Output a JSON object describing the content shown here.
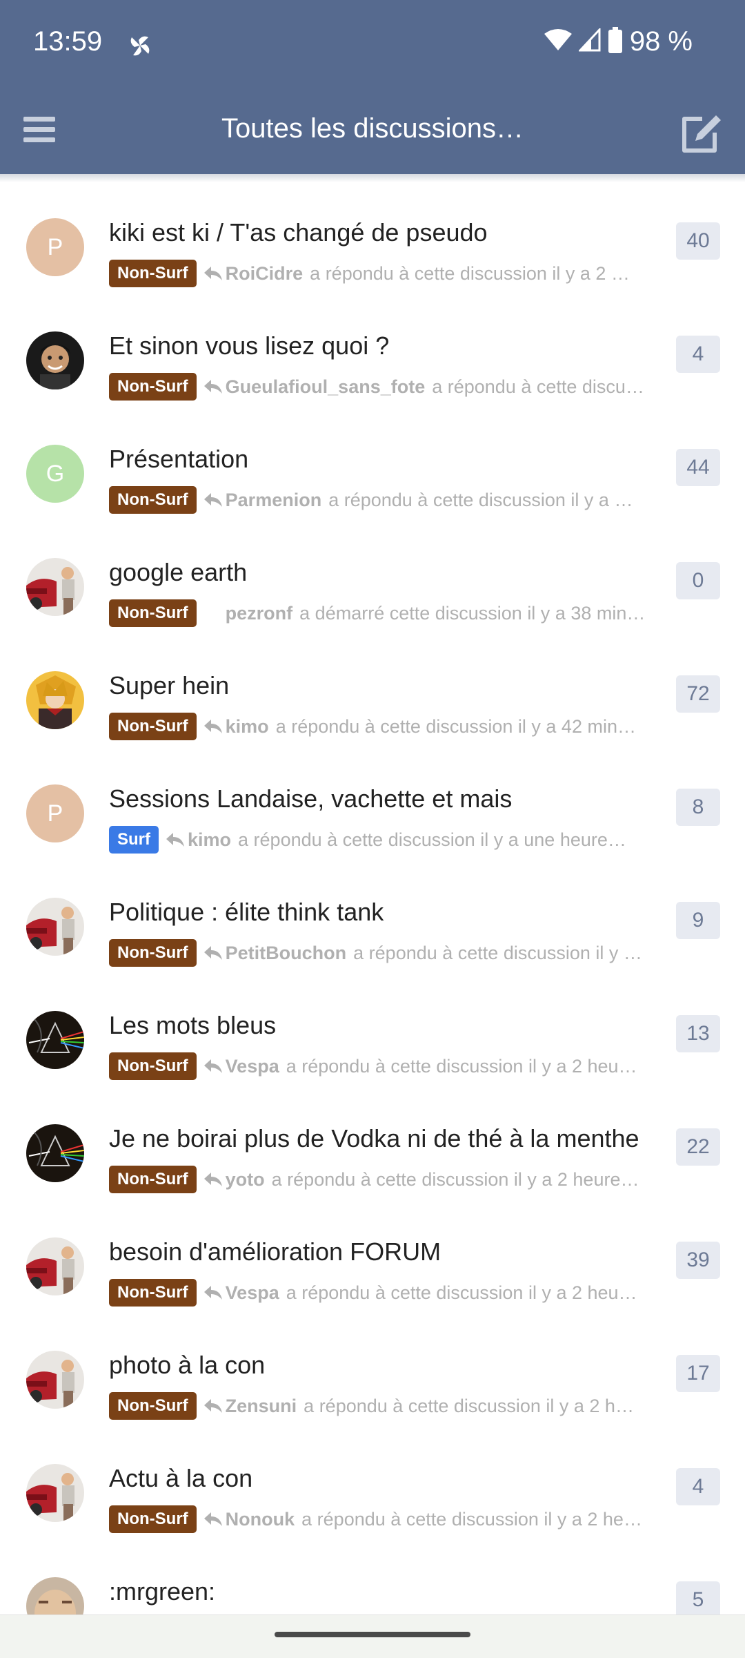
{
  "status_bar": {
    "time": "13:59",
    "battery": "98 %",
    "icons": [
      "pinwheel-icon",
      "wifi-icon",
      "signal-icon",
      "battery-icon"
    ]
  },
  "toolbar": {
    "title": "Toutes les discussions…",
    "menu_icon": "hamburger-menu-icon",
    "compose_icon": "compose-icon"
  },
  "colors": {
    "appbar": "#566a8f",
    "tag_non_surf": "#7a4116",
    "tag_surf": "#3a7ae6",
    "count_bg": "#e7eaf1"
  },
  "discussions": [
    {
      "title": "kiki est ki / T'as changé de pseudo",
      "tag": "Non-Surf",
      "user": "RoiCidre",
      "desc": "a répondu à cette discussion il y a 2 …",
      "count": "40",
      "avatar_letter": "P",
      "avatar_kind": "letter-peach",
      "reply": true
    },
    {
      "title": "Et sinon vous lisez quoi ?",
      "tag": "Non-Surf",
      "user": "Gueulafioul_sans_fote",
      "desc": "a répondu à cette discu…",
      "count": "4",
      "avatar_letter": "",
      "avatar_kind": "photo-man",
      "reply": true
    },
    {
      "title": "Présentation",
      "tag": "Non-Surf",
      "user": "Parmenion",
      "desc": "a répondu à cette discussion il y a …",
      "count": "44",
      "avatar_letter": "G",
      "avatar_kind": "letter-green",
      "reply": true
    },
    {
      "title": "google earth",
      "tag": "Non-Surf",
      "user": "pezronf",
      "desc": "a démarré cette discussion il y a 38 minu…",
      "count": "0",
      "avatar_letter": "",
      "avatar_kind": "photo-car",
      "reply": false
    },
    {
      "title": "Super hein",
      "tag": "Non-Surf",
      "user": "kimo",
      "desc": "a répondu à cette discussion il y a 42 min…",
      "count": "72",
      "avatar_letter": "",
      "avatar_kind": "photo-anime",
      "reply": true
    },
    {
      "title": "Sessions Landaise, vachette et mais",
      "tag": "Surf",
      "user": "kimo",
      "desc": "a répondu à cette discussion il y a une heure…",
      "count": "8",
      "avatar_letter": "P",
      "avatar_kind": "letter-peach",
      "reply": true
    },
    {
      "title": "Politique : élite think tank",
      "tag": "Non-Surf",
      "user": "PetitBouchon",
      "desc": "a répondu à cette discussion il y …",
      "count": "9",
      "avatar_letter": "",
      "avatar_kind": "photo-car",
      "reply": true
    },
    {
      "title": "Les mots bleus",
      "tag": "Non-Surf",
      "user": "Vespa",
      "desc": "a répondu à cette discussion il y a 2 heu…",
      "count": "13",
      "avatar_letter": "",
      "avatar_kind": "photo-prism",
      "reply": true
    },
    {
      "title": "Je ne boirai plus de Vodka ni de thé à la menthe",
      "tag": "Non-Surf",
      "user": "yoto",
      "desc": "a répondu à cette discussion il y a 2 heure…",
      "count": "22",
      "avatar_letter": "",
      "avatar_kind": "photo-prism",
      "reply": true
    },
    {
      "title": "besoin d'amélioration FORUM",
      "tag": "Non-Surf",
      "user": "Vespa",
      "desc": "a répondu à cette discussion il y a 2 heu…",
      "count": "39",
      "avatar_letter": "",
      "avatar_kind": "photo-car",
      "reply": true
    },
    {
      "title": "photo à la con",
      "tag": "Non-Surf",
      "user": "Zensuni",
      "desc": "a répondu à cette discussion il y a 2 h…",
      "count": "17",
      "avatar_letter": "",
      "avatar_kind": "photo-car",
      "reply": true
    },
    {
      "title": "Actu à la con",
      "tag": "Non-Surf",
      "user": "Nonouk",
      "desc": "a répondu à cette discussion il y a 2 he…",
      "count": "4",
      "avatar_letter": "",
      "avatar_kind": "photo-car",
      "reply": true
    },
    {
      "title": ":mrgreen:",
      "tag": "",
      "user": "",
      "desc": "",
      "count": "5",
      "avatar_letter": "",
      "avatar_kind": "photo-face",
      "reply": false
    }
  ]
}
